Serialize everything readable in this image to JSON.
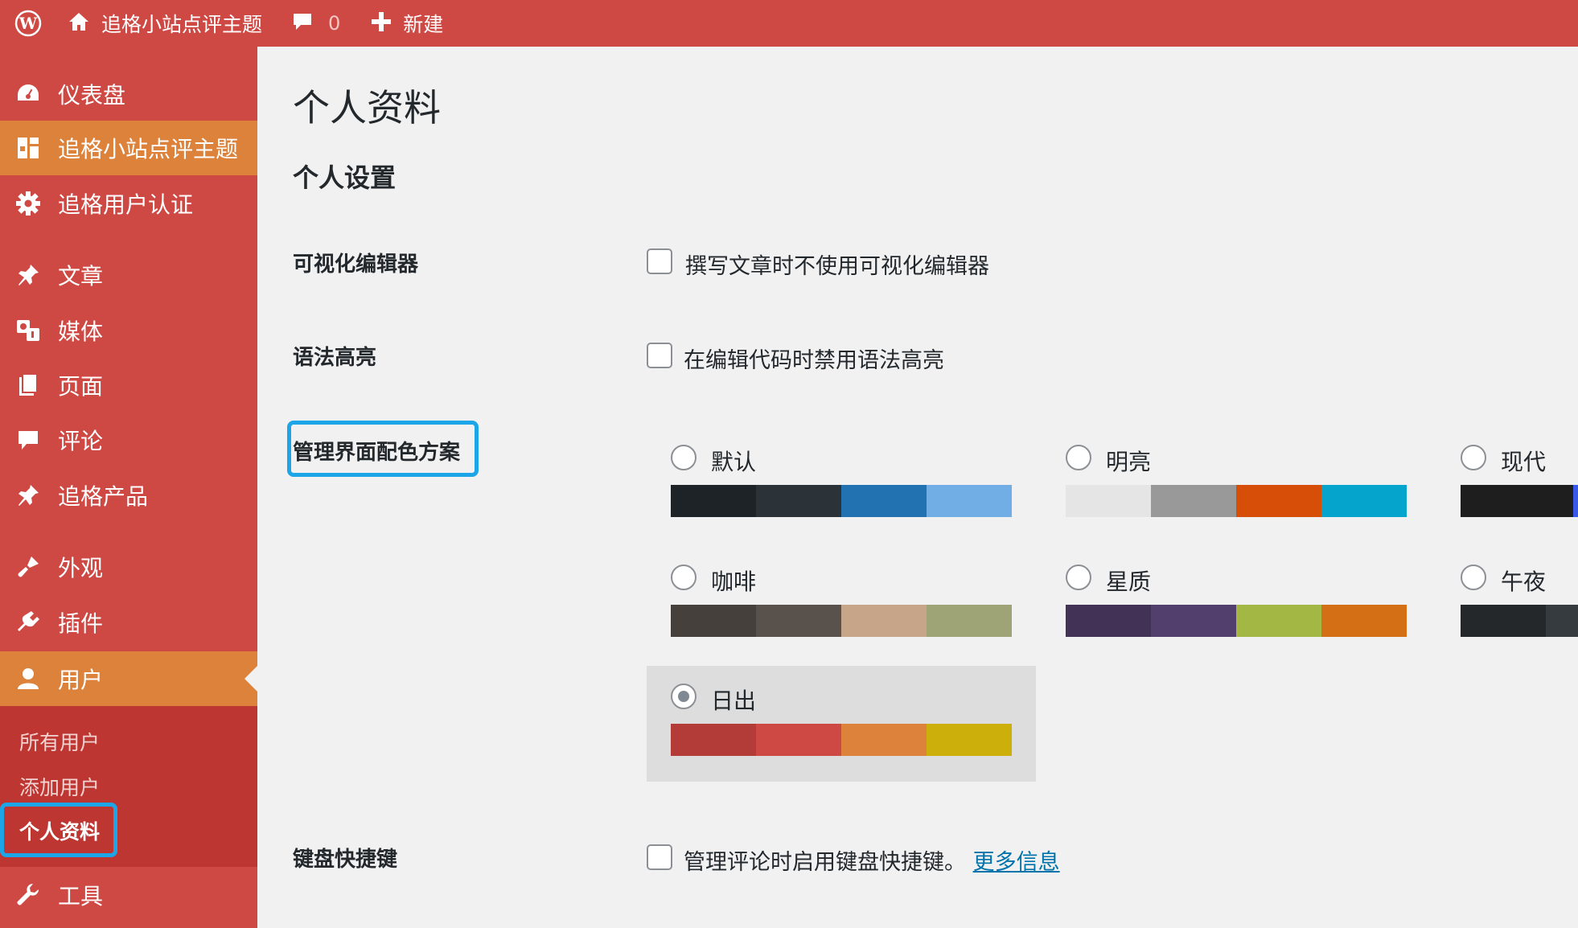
{
  "adminbar": {
    "site_name": "追格小站点评主题",
    "comment_count": "0",
    "new_label": "新建"
  },
  "sidebar": {
    "items": [
      {
        "label": "仪表盘",
        "icon": "dashboard-icon"
      },
      {
        "label": "追格小站点评主题",
        "icon": "theme-layout-icon"
      },
      {
        "label": "追格用户认证",
        "icon": "gear-icon"
      },
      {
        "label": "文章",
        "icon": "pin-icon"
      },
      {
        "label": "媒体",
        "icon": "media-icon"
      },
      {
        "label": "页面",
        "icon": "page-icon"
      },
      {
        "label": "评论",
        "icon": "comment-icon"
      },
      {
        "label": "追格产品",
        "icon": "pin-icon"
      },
      {
        "label": "外观",
        "icon": "brush-icon"
      },
      {
        "label": "插件",
        "icon": "plugin-icon"
      },
      {
        "label": "用户",
        "icon": "user-icon"
      },
      {
        "label": "工具",
        "icon": "wrench-icon"
      }
    ],
    "submenu": [
      "所有用户",
      "添加用户",
      "个人资料"
    ]
  },
  "main": {
    "page_title": "个人资料",
    "section_title": "个人设置",
    "visual_editor": {
      "label": "可视化编辑器",
      "option": "撰写文章时不使用可视化编辑器"
    },
    "syntax": {
      "label": "语法高亮",
      "option": "在编辑代码时禁用语法高亮"
    },
    "color_scheme": {
      "label": "管理界面配色方案",
      "schemes": [
        {
          "name": "默认",
          "colors": [
            "#1d2327",
            "#2c3338",
            "#2271b1",
            "#72aee6"
          ],
          "selected": false
        },
        {
          "name": "明亮",
          "colors": [
            "#e5e5e5",
            "#999999",
            "#d64e07",
            "#04a4cc"
          ],
          "selected": false
        },
        {
          "name": "现代",
          "colors": [
            "#1e1e1e",
            "#3858e9"
          ],
          "selected": false
        },
        {
          "name": "咖啡",
          "colors": [
            "#46403c",
            "#59524c",
            "#c7a589",
            "#9ea476"
          ],
          "selected": false
        },
        {
          "name": "星质",
          "colors": [
            "#413256",
            "#523f6d",
            "#a3b745",
            "#d46f15"
          ],
          "selected": false
        },
        {
          "name": "午夜",
          "colors": [
            "#25282b",
            "#363b3f"
          ],
          "selected": false
        },
        {
          "name": "日出",
          "colors": [
            "#b43c38",
            "#cf4944",
            "#dd823b",
            "#ccaf0b"
          ],
          "selected": true
        }
      ]
    },
    "keyboard": {
      "label": "键盘快捷键",
      "option": "管理评论时启用键盘快捷键。",
      "link": "更多信息"
    }
  }
}
